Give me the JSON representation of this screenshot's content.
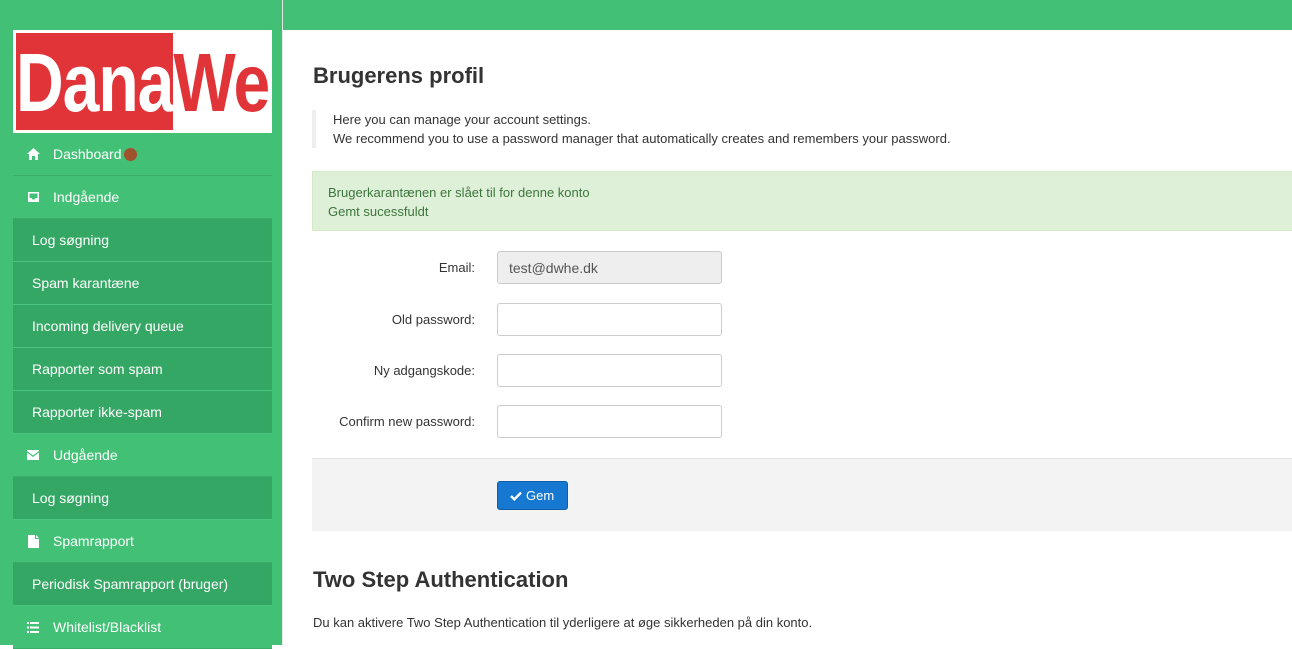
{
  "logo": {
    "left": "Dana",
    "right": "Web"
  },
  "sidebar": {
    "items": [
      {
        "label": "Dashboard",
        "type": "section",
        "icon": "home-icon"
      },
      {
        "label": "Indgående",
        "type": "section",
        "icon": "inbox-icon"
      },
      {
        "label": "Log søgning",
        "type": "sub"
      },
      {
        "label": "Spam karantæne",
        "type": "sub"
      },
      {
        "label": "Incoming delivery queue",
        "type": "sub"
      },
      {
        "label": "Rapporter som spam",
        "type": "sub"
      },
      {
        "label": "Rapporter ikke-spam",
        "type": "sub"
      },
      {
        "label": "Udgående",
        "type": "section",
        "icon": "envelope-icon"
      },
      {
        "label": "Log søgning",
        "type": "sub"
      },
      {
        "label": "Spamrapport",
        "type": "section",
        "icon": "file-icon"
      },
      {
        "label": "Periodisk Spamrapport (bruger)",
        "type": "sub"
      },
      {
        "label": "Whitelist/Blacklist",
        "type": "section",
        "icon": "list-icon"
      }
    ]
  },
  "main": {
    "title": "Brugerens profil",
    "intro": [
      "Here you can manage your account settings.",
      "We recommend you to use a password manager that automatically creates and remembers your password."
    ],
    "alert": [
      "Brugerkarantænen er slået til for denne konto",
      "Gemt sucessfuldt"
    ],
    "form": {
      "email_label": "Email:",
      "email_value": "test@dwhe.dk",
      "old_password_label": "Old password:",
      "new_password_label": "Ny adgangskode:",
      "confirm_password_label": "Confirm new password:",
      "save_label": "Gem"
    },
    "two_step": {
      "title": "Two Step Authentication",
      "text": "Du kan aktivere Two Step Authentication til yderligere at øge sikkerheden på din konto."
    }
  },
  "colors": {
    "sidebar": "#42c176",
    "sidebar_sub": "#35a765",
    "logo_red": "#e03438",
    "alert_bg": "#dff0d8",
    "alert_text": "#3c763d",
    "primary": "#1678d0"
  }
}
